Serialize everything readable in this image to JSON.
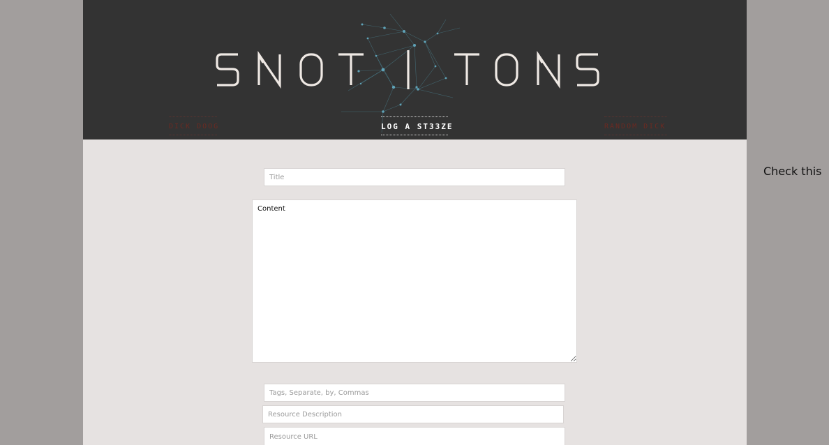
{
  "header": {
    "logo_alt": "SNOT | TONS",
    "nav": {
      "left_label": "DICK DOOG",
      "center_label": "LOG A ST33ZE",
      "right_label": "RANDOM DICK"
    }
  },
  "form": {
    "title_placeholder": "Title",
    "content_placeholder": "Content",
    "tags_placeholder": "Tags, Separate, by, Commas",
    "resource_description_placeholder": "Resource Description",
    "resource_url_placeholder": "Resource URL"
  },
  "side": {
    "text": "Check this"
  },
  "colors": {
    "page_background": "#a29e9d",
    "content_background": "#e6e2e1",
    "header_background": "#333333",
    "network_node": "#4f8fa3",
    "nav_inactive": "#6b2a22"
  },
  "icons": {
    "logo": "snot-tons-logo",
    "network_graphic": "network-graph-decoration"
  }
}
